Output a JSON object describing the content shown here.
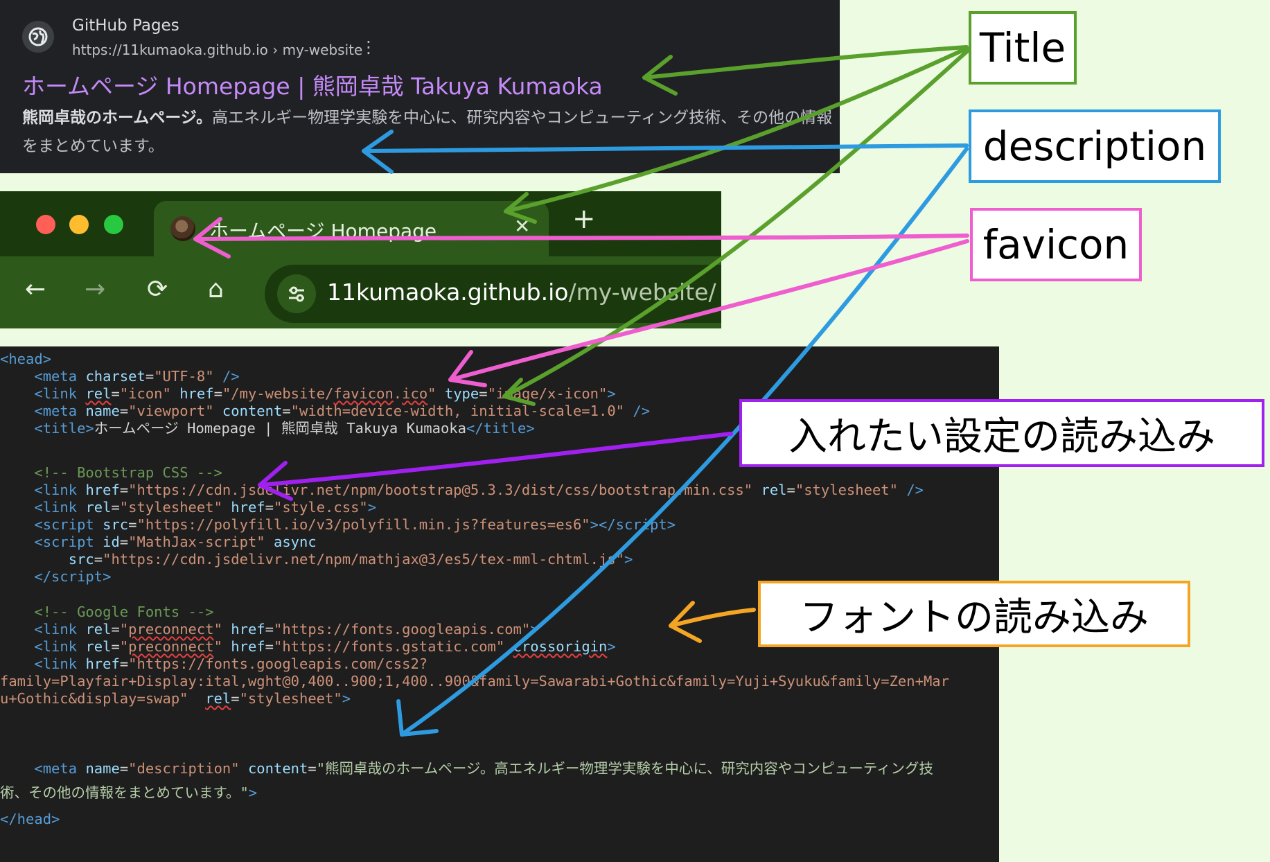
{
  "search_result": {
    "site_name": "GitHub Pages",
    "site_url": "https://11kumaoka.github.io › my-website",
    "more_icon": "more-vertical-icon",
    "title": "ホームページ Homepage | 熊岡卓哉 Takuya Kumaoka",
    "description_bold": "熊岡卓哉のホームページ。",
    "description_rest": "高エネルギー物理学実験を中心に、研究内容やコンピューティング技術、その他の情報をまとめています。"
  },
  "browser": {
    "tab_title": "ホームページ Homepage | 熊岡卓哉 Takuya Kumaoka",
    "tab_close": "✕",
    "new_tab": "+",
    "nav": {
      "back": "←",
      "forward": "→",
      "reload": "⟳",
      "home": "⌂"
    },
    "url_host": "11kumaoka.github.io",
    "url_path": "/my-website/"
  },
  "code": {
    "head_open": "<head>",
    "head_close": "</head>",
    "comment_bootstrap": "<!-- Bootstrap CSS -->",
    "comment_fonts": "<!-- Google Fonts -->"
  },
  "labels": {
    "title": "Title",
    "description": "description",
    "favicon": "favicon",
    "settings": "入れたい設定の読み込み",
    "fonts": "フォントの読み込み"
  },
  "colors": {
    "title_arrow": "#5aa02c",
    "description_arrow": "#2e9be0",
    "favicon_arrow": "#ee5ecf",
    "settings_arrow": "#a020f0",
    "fonts_arrow": "#f5a524"
  }
}
